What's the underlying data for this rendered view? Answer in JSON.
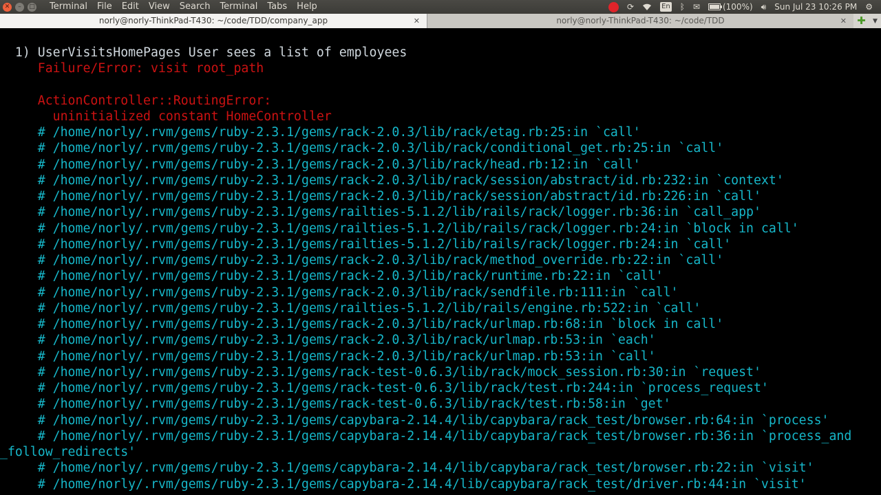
{
  "menubar": {
    "app_name": "Terminal",
    "menus": [
      "File",
      "Edit",
      "View",
      "Search",
      "Terminal",
      "Tabs",
      "Help"
    ],
    "keyboard_layout": "En",
    "battery_text": "(100%)",
    "battery_level": 1.0,
    "clock": "Sun Jul 23 10:26 PM",
    "record_color": "#e0242a"
  },
  "tabs": [
    {
      "title": "norly@norly-ThinkPad-T430: ~/code/TDD/company_app",
      "active": true
    },
    {
      "title": "norly@norly-ThinkPad-T430: ~/code/TDD",
      "active": false
    }
  ],
  "terminal": {
    "colors": {
      "text": "#d0d8de",
      "error": "#cc1212",
      "trace": "#16b7c9",
      "background": "#000000"
    },
    "failure_header": "  1) UserVisitsHomePages User sees a list of employees",
    "failure_error": "     Failure/Error: visit root_path",
    "error_class": "     ActionController::RoutingError:",
    "error_message": "       uninitialized constant HomeController",
    "backtrace": [
      "     # /home/norly/.rvm/gems/ruby-2.3.1/gems/rack-2.0.3/lib/rack/etag.rb:25:in `call'",
      "     # /home/norly/.rvm/gems/ruby-2.3.1/gems/rack-2.0.3/lib/rack/conditional_get.rb:25:in `call'",
      "     # /home/norly/.rvm/gems/ruby-2.3.1/gems/rack-2.0.3/lib/rack/head.rb:12:in `call'",
      "     # /home/norly/.rvm/gems/ruby-2.3.1/gems/rack-2.0.3/lib/rack/session/abstract/id.rb:232:in `context'",
      "     # /home/norly/.rvm/gems/ruby-2.3.1/gems/rack-2.0.3/lib/rack/session/abstract/id.rb:226:in `call'",
      "     # /home/norly/.rvm/gems/ruby-2.3.1/gems/railties-5.1.2/lib/rails/rack/logger.rb:36:in `call_app'",
      "     # /home/norly/.rvm/gems/ruby-2.3.1/gems/railties-5.1.2/lib/rails/rack/logger.rb:24:in `block in call'",
      "     # /home/norly/.rvm/gems/ruby-2.3.1/gems/railties-5.1.2/lib/rails/rack/logger.rb:24:in `call'",
      "     # /home/norly/.rvm/gems/ruby-2.3.1/gems/rack-2.0.3/lib/rack/method_override.rb:22:in `call'",
      "     # /home/norly/.rvm/gems/ruby-2.3.1/gems/rack-2.0.3/lib/rack/runtime.rb:22:in `call'",
      "     # /home/norly/.rvm/gems/ruby-2.3.1/gems/rack-2.0.3/lib/rack/sendfile.rb:111:in `call'",
      "     # /home/norly/.rvm/gems/ruby-2.3.1/gems/railties-5.1.2/lib/rails/engine.rb:522:in `call'",
      "     # /home/norly/.rvm/gems/ruby-2.3.1/gems/rack-2.0.3/lib/rack/urlmap.rb:68:in `block in call'",
      "     # /home/norly/.rvm/gems/ruby-2.3.1/gems/rack-2.0.3/lib/rack/urlmap.rb:53:in `each'",
      "     # /home/norly/.rvm/gems/ruby-2.3.1/gems/rack-2.0.3/lib/rack/urlmap.rb:53:in `call'",
      "     # /home/norly/.rvm/gems/ruby-2.3.1/gems/rack-test-0.6.3/lib/rack/mock_session.rb:30:in `request'",
      "     # /home/norly/.rvm/gems/ruby-2.3.1/gems/rack-test-0.6.3/lib/rack/test.rb:244:in `process_request'",
      "     # /home/norly/.rvm/gems/ruby-2.3.1/gems/rack-test-0.6.3/lib/rack/test.rb:58:in `get'",
      "     # /home/norly/.rvm/gems/ruby-2.3.1/gems/capybara-2.14.4/lib/capybara/rack_test/browser.rb:64:in `process'",
      "     # /home/norly/.rvm/gems/ruby-2.3.1/gems/capybara-2.14.4/lib/capybara/rack_test/browser.rb:36:in `process_and",
      "_follow_redirects'",
      "     # /home/norly/.rvm/gems/ruby-2.3.1/gems/capybara-2.14.4/lib/capybara/rack_test/browser.rb:22:in `visit'",
      "     # /home/norly/.rvm/gems/ruby-2.3.1/gems/capybara-2.14.4/lib/capybara/rack_test/driver.rb:44:in `visit'"
    ]
  }
}
